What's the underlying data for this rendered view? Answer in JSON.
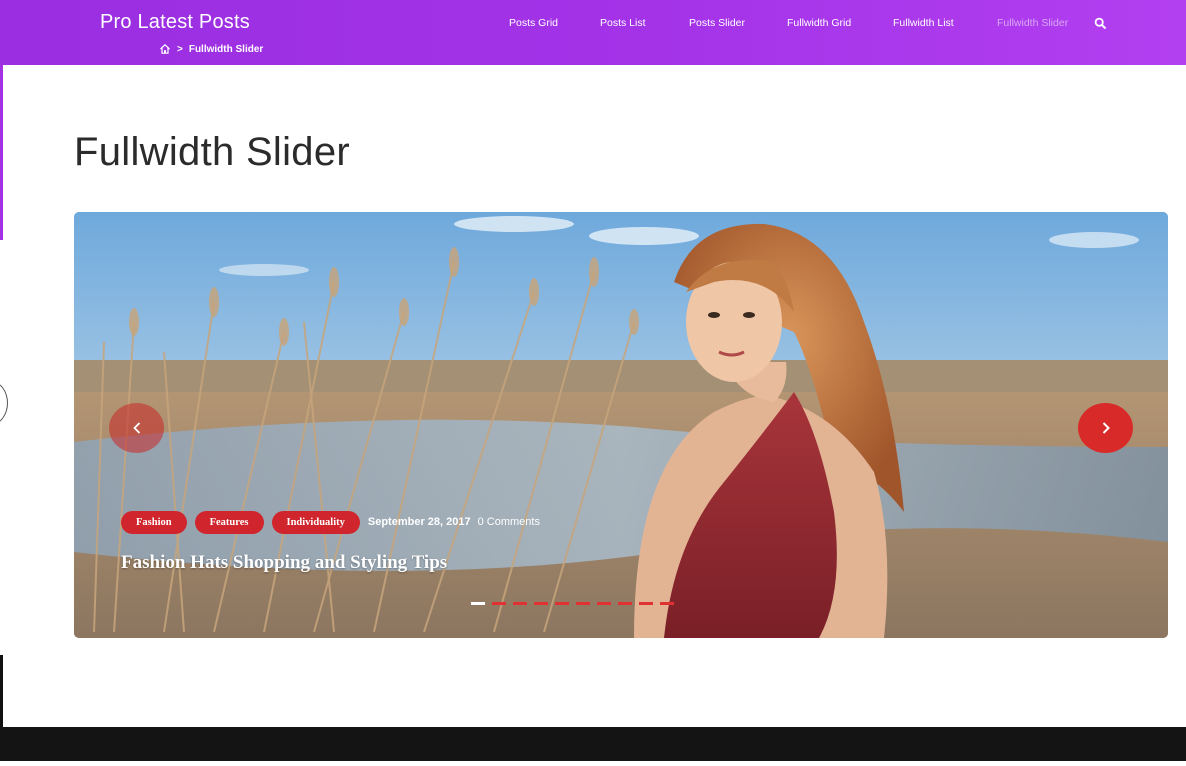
{
  "header": {
    "site_title": "Pro Latest Posts",
    "breadcrumb": {
      "current": "Fullwidth Slider",
      "separator": ">"
    },
    "nav": [
      {
        "label": "Posts Grid",
        "active": false
      },
      {
        "label": "Posts List",
        "active": false
      },
      {
        "label": "Posts Slider",
        "active": false
      },
      {
        "label": "Fullwidth Grid",
        "active": false
      },
      {
        "label": "Fullwidth List",
        "active": false
      },
      {
        "label": "Fullwidth Slider",
        "active": true
      }
    ],
    "colors": {
      "gradient_start": "#9a2ee0",
      "gradient_end": "#b23ff0",
      "active_nav": "#d9a8f5"
    }
  },
  "page": {
    "title": "Fullwidth Slider"
  },
  "slider": {
    "slide": {
      "tags": [
        "Fashion",
        "Features",
        "Individuality"
      ],
      "date": "September 28, 2017",
      "comments": "0 Comments",
      "title": "Fashion Hats Shopping and Styling Tips"
    },
    "slide_count": 10,
    "active_slide": 1,
    "colors": {
      "accent": "#d0252c",
      "arrow_next": "#d92a2a"
    }
  },
  "icons": {
    "home": "home-icon",
    "search": "search-icon",
    "prev": "chevron-left-icon",
    "next": "chevron-right-icon"
  }
}
